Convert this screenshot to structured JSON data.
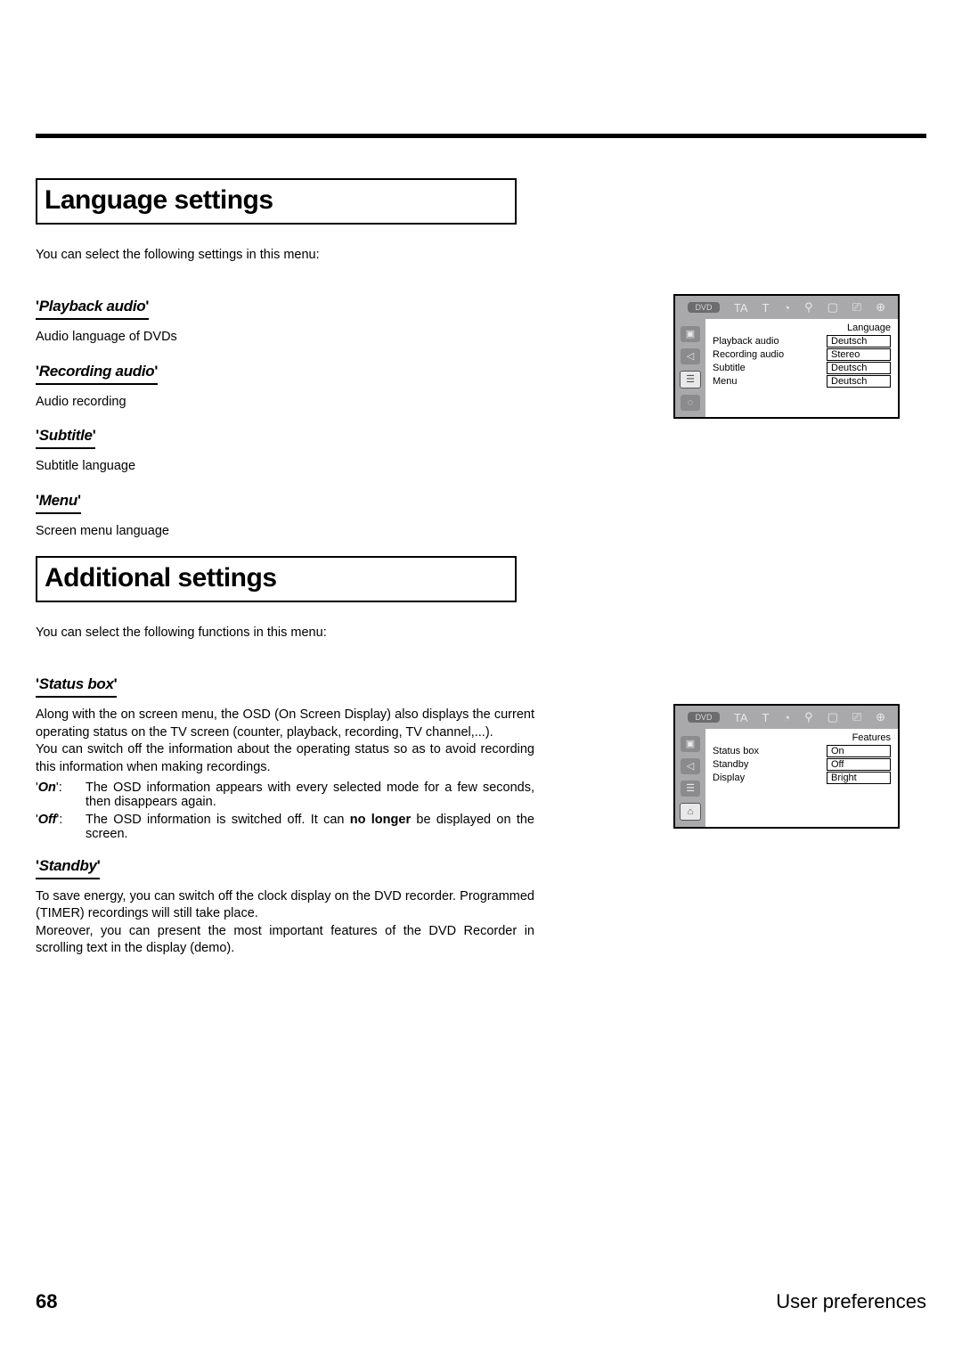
{
  "page_number": "68",
  "chapter_title": "User preferences",
  "section1": {
    "title": "Language settings",
    "intro": "You can select the following settings in this menu:",
    "items": [
      {
        "heading": "Playback audio",
        "body": "Audio language of DVDs"
      },
      {
        "heading": "Recording audio",
        "body": "Audio recording"
      },
      {
        "heading": "Subtitle",
        "body": "Subtitle language"
      },
      {
        "heading": "Menu",
        "body": "Screen menu language"
      }
    ]
  },
  "section2": {
    "title": "Additional settings",
    "intro": "You can select the following functions in this menu:",
    "items": [
      {
        "heading": "Status box",
        "body": "Along with the on screen menu, the OSD (On Screen Display) also displays the current operating status on the TV screen (counter, playback, recording, TV channel,...).\nYou can switch off the information about the operating status so as to avoid recording this information when making recordings.",
        "defs": [
          {
            "key": "On",
            "val": "The OSD information appears with every selected mode for a few seconds, then disappears again."
          },
          {
            "key": "Off",
            "val_pre": "The OSD information is switched off. It can ",
            "val_bold": "no longer",
            "val_post": " be displayed on the screen."
          }
        ]
      },
      {
        "heading": "Standby",
        "body": "To save energy, you can switch off the clock display on the DVD recorder. Programmed (TIMER) recordings will still take place.\nMoreover, you can present the most important features of the DVD Recorder in scrolling text in the display (demo)."
      }
    ]
  },
  "osd1": {
    "heading": "Language",
    "rows": [
      {
        "lbl": "Playback audio",
        "val": "Deutsch"
      },
      {
        "lbl": "Recording audio",
        "val": "Stereo"
      },
      {
        "lbl": "Subtitle",
        "val": "Deutsch"
      },
      {
        "lbl": "Menu",
        "val": "Deutsch"
      }
    ],
    "toolbar_label": "DVD"
  },
  "osd2": {
    "heading": "Features",
    "rows": [
      {
        "lbl": "Status box",
        "val": "On"
      },
      {
        "lbl": "Standby",
        "val": "Off"
      },
      {
        "lbl": "Display",
        "val": "Bright"
      }
    ],
    "toolbar_label": "DVD"
  }
}
